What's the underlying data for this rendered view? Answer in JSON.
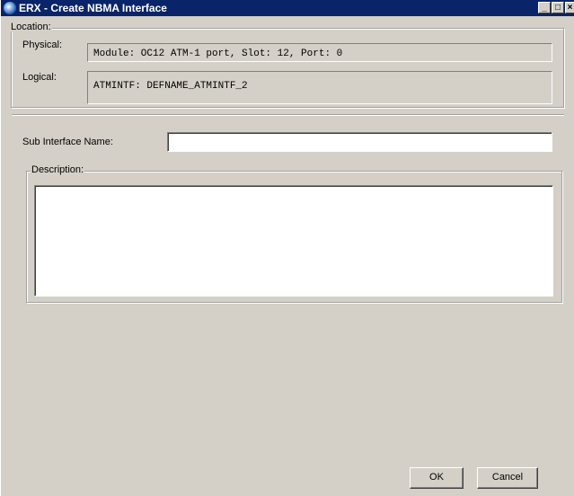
{
  "window": {
    "title": "ERX - Create NBMA Interface",
    "controls": {
      "minimize": "_",
      "maximize": "□",
      "close": "×"
    }
  },
  "location": {
    "legend": "Location:",
    "physical_label": "Physical:",
    "physical_value": "Module: OC12 ATM-1 port, Slot: 12, Port: 0",
    "logical_label": "Logical:",
    "logical_value": "ATMINTF: DEFNAME_ATMINTF_2"
  },
  "form": {
    "sub_interface_label": "Sub Interface Name:",
    "sub_interface_value": "",
    "description_legend": "Description:",
    "description_value": ""
  },
  "buttons": {
    "ok": "OK",
    "cancel": "Cancel"
  }
}
